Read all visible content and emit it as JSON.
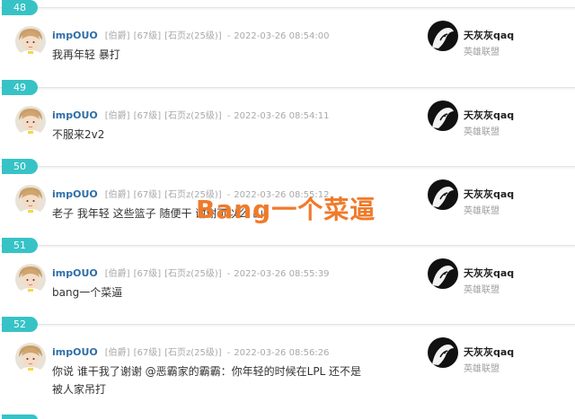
{
  "posts": [
    {
      "floor": "48",
      "author": "impOUO",
      "rank": "[伯爵]",
      "level": "[67级]",
      "pages": "[石页z(25级)]",
      "sep": "-",
      "time": "2022-03-26 08:54:00",
      "content": "我再年轻 暴打",
      "lz_name": "天灰灰qaq",
      "lz_sub": "英雄联盟"
    },
    {
      "floor": "49",
      "author": "impOUO",
      "rank": "[伯爵]",
      "level": "[67级]",
      "pages": "[石页z(25级)]",
      "sep": "-",
      "time": "2022-03-26 08:54:11",
      "content": "不服来2v2",
      "lz_name": "天灰灰qaq",
      "lz_sub": "英雄联盟"
    },
    {
      "floor": "50",
      "author": "impOUO",
      "rank": "[伯爵]",
      "level": "[67级]",
      "pages": "[石页z(25级)]",
      "sep": "-",
      "time": "2022-03-26 08:55:12",
      "content": "老子 我年轻 这些篮子 随便干 谢谢可以么 山",
      "lz_name": "天灰灰qaq",
      "lz_sub": "英雄联盟"
    },
    {
      "floor": "51",
      "author": "impOUO",
      "rank": "[伯爵]",
      "level": "[67级]",
      "pages": "[石页z(25级)]",
      "sep": "-",
      "time": "2022-03-26 08:55:39",
      "content": "bang一个菜逼",
      "lz_name": "天灰灰qaq",
      "lz_sub": "英雄联盟"
    },
    {
      "floor": "52",
      "author": "impOUO",
      "rank": "[伯爵]",
      "level": "[67级]",
      "pages": "[石页z(25级)]",
      "sep": "-",
      "time": "2022-03-26 08:56:26",
      "content": "你说 谁干我了谢谢 @恶霸家的霸霸：你年轻的时候在LPL 还不是被人家吊打",
      "lz_name": "天灰灰qaq",
      "lz_sub": "英雄联盟"
    }
  ],
  "overlay_caption": "Bang一个菜逼",
  "colors": {
    "badge": "#37c3c6",
    "author": "#2e6ea6",
    "meta": "#a9a9a9",
    "caption": "#f07a2a"
  },
  "icons": {
    "author_avatar": "user-avatar-icon",
    "lz_avatar": "lz-avatar-icon"
  }
}
